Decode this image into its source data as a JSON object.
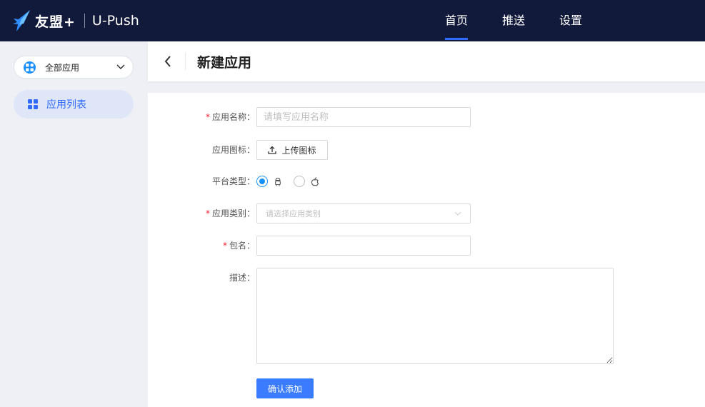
{
  "brand": {
    "name": "友盟+",
    "product": "U-Push"
  },
  "nav": {
    "home": "首页",
    "push": "推送",
    "settings": "设置",
    "active": "home"
  },
  "sidebar": {
    "app_select_label": "全部应用",
    "items": [
      {
        "label": "应用列表",
        "icon": "grid-icon",
        "active": true
      }
    ]
  },
  "page": {
    "title": "新建应用"
  },
  "form": {
    "required_mark": "*",
    "app_name": {
      "label": "应用名称：",
      "placeholder": "请填写应用名称",
      "value": ""
    },
    "app_icon": {
      "label": "应用图标：",
      "button_label": "上传图标"
    },
    "platform": {
      "label": "平台类型：",
      "options": [
        {
          "icon": "android-icon",
          "checked": true
        },
        {
          "icon": "apple-icon",
          "checked": false
        }
      ]
    },
    "category": {
      "label": "应用类别：",
      "placeholder": "请选择应用类别"
    },
    "package": {
      "label": "包名：",
      "value": ""
    },
    "description": {
      "label": "描述：",
      "value": ""
    },
    "submit_label": "确认添加"
  },
  "colors": {
    "topbar_bg": "#111a3b",
    "accent": "#2f6bff",
    "primary_button": "#3b7cff",
    "radio_active": "#1890ff",
    "required": "#f5222d"
  }
}
